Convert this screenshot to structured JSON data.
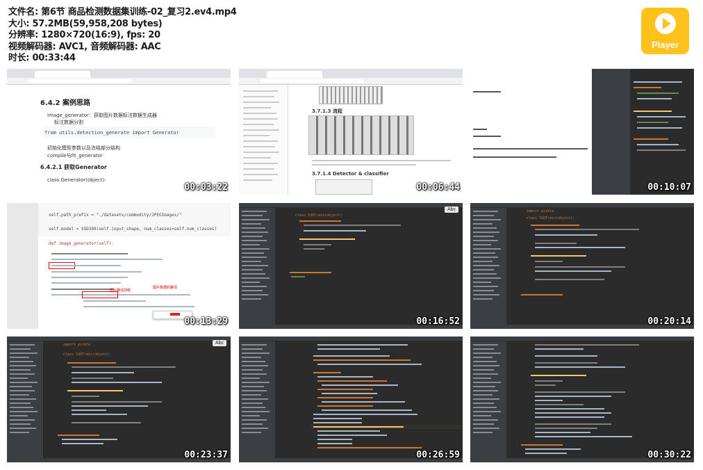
{
  "info": {
    "filename": "文件名: 第6节  商品检测数据集训练-02_复习2.ev4.mp4",
    "size": "大小: 57.2MB(59,958,208 bytes)",
    "resolution": "分辨率: 1280×720(16:9), fps: 20",
    "codec": "视频解码器: AVC1, 音频解码器: AAC",
    "duration": "时长: 00:33:44"
  },
  "logo": {
    "label": "Player",
    "icon": "play-icon",
    "color": "#ffc21a"
  },
  "thumbnails": [
    {
      "time": "00:03:22",
      "heading": "6.4.2 案例思路",
      "bullet1": "image_generator：获取图片数据标注数据生成器",
      "bullet2": "标注数据分割",
      "code": "from utils.detection_generate import Generator",
      "bullet3": "初始化模型参数以及冻结部分结构",
      "bullet4": "compile与fit_generator",
      "heading2": "6.4.2.1 获取Generator",
      "bullet5": "class Generator(object):"
    },
    {
      "time": "00:06:44",
      "section": "3.7.1.3 流程",
      "section2": "3.7.1.4 Detector & classifier"
    },
    {
      "time": "00:10:07"
    },
    {
      "time": "00:13:29",
      "code1": "self.path_prefix = \"./datasets/commodity/JPEGImages/\"",
      "code2": "self.model = SSD300(self.input_shape, num_classes=self.num_classes)",
      "code3": "def image_generator(self):",
      "annot": "图片路径前缀",
      "annot2": "图片数据的路径"
    },
    {
      "time": "00:16:52",
      "abc": "Abc",
      "code_class": "class SSDTrain(object):"
    },
    {
      "time": "00:20:14",
      "code_import": "import pickle",
      "code_class": "class SSDTrain(object):"
    },
    {
      "time": "00:23:37",
      "abc": "Abc",
      "code_import": "import pickle",
      "code_class": "class SSDTrain(object):"
    },
    {
      "time": "00:26:59"
    },
    {
      "time": "00:30:22"
    }
  ]
}
